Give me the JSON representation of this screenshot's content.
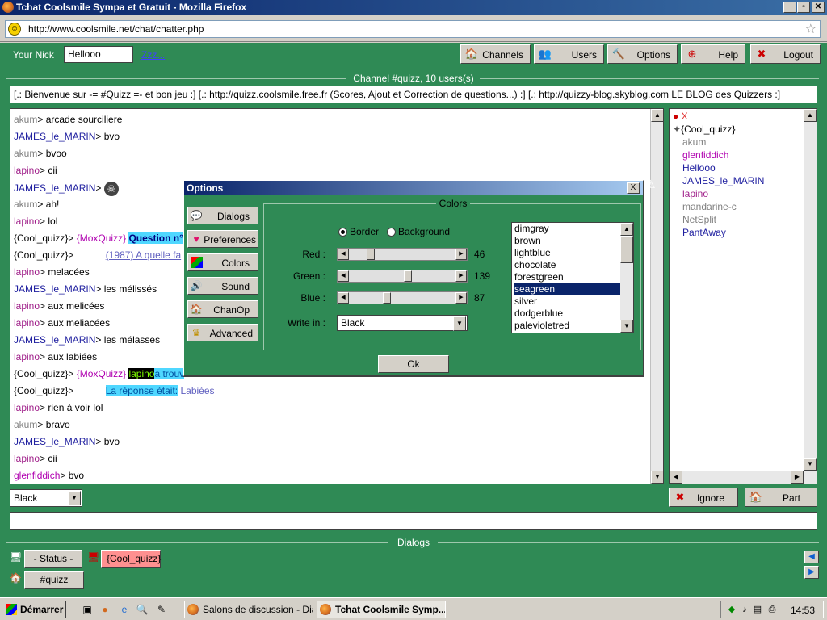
{
  "window": {
    "title": "Tchat Coolsmile Sympa et Gratuit - Mozilla Firefox",
    "minimize": "_",
    "maximize": "▫",
    "close": "✕"
  },
  "browser": {
    "url": "http://www.coolsmile.net/chat/chatter.php"
  },
  "header": {
    "nick_label": "Your Nick",
    "nick_value": "Hellooo",
    "zzz_link": "Zzz...",
    "buttons": [
      {
        "label": "Channels",
        "icon": "house-icon"
      },
      {
        "label": "Users",
        "icon": "users-icon"
      },
      {
        "label": "Options",
        "icon": "hammer-icon"
      },
      {
        "label": "Help",
        "icon": "lifebuoy-icon"
      },
      {
        "label": "Logout",
        "icon": "logout-icon"
      }
    ]
  },
  "channel": {
    "title": "Channel #quizz, 10 users(s)",
    "topic": "[.: Bienvenue sur -= #Quizz =- et bon jeu :] [.:  http://quizz.coolsmile.free.fr (Scores, Ajout et Correction de questions...) :] [.: http://quizzy-blog.skyblog.com LE BLOG des Quizzers :]"
  },
  "chat": {
    "lines": [
      {
        "nick": "akum",
        "sep": "> ",
        "text": "arcade sourciliere",
        "color": "gray"
      },
      {
        "nick": "JAMES_le_MARIN",
        "sep": "> ",
        "text": "bvo",
        "color": "blue"
      },
      {
        "nick": "akum",
        "sep": "> ",
        "text": "bvoo",
        "color": "gray"
      },
      {
        "nick": "lapino",
        "sep": "> ",
        "text": "cii",
        "color": "purple"
      },
      {
        "nick": "JAMES_le_MARIN",
        "sep": "> ",
        "text": "",
        "color": "blue",
        "icon": "skull-icon"
      },
      {
        "nick": "akum",
        "sep": "> ",
        "text": "ah!",
        "color": "gray"
      },
      {
        "nick": "lapino",
        "sep": "> ",
        "text": "lol",
        "color": "purple"
      },
      {
        "nick": "{Cool_quizz}",
        "sep": "> ",
        "text": "",
        "color": "black",
        "extra": "{MoxQuizz}",
        "highlight": "Question n°"
      },
      {
        "nick": "{Cool_quizz}",
        "sep": "> ",
        "text": "",
        "color": "black",
        "link": "(1987) A quelle fa"
      },
      {
        "nick": "lapino",
        "sep": "> ",
        "text": "melacées",
        "color": "purple"
      },
      {
        "nick": "JAMES_le_MARIN",
        "sep": "> ",
        "text": "les mélissés",
        "color": "blue"
      },
      {
        "nick": "lapino",
        "sep": "> ",
        "text": "aux melicées",
        "color": "purple"
      },
      {
        "nick": "lapino",
        "sep": "> ",
        "text": "aux meliacées",
        "color": "purple"
      },
      {
        "nick": "JAMES_le_MARIN",
        "sep": "> ",
        "text": "les mélasses",
        "color": "blue"
      },
      {
        "nick": "lapino",
        "sep": "> ",
        "text": "aux labiées",
        "color": "purple"
      },
      {
        "nick": "{Cool_quizz}",
        "sep": "> ",
        "text": "",
        "color": "black",
        "extra": "{MoxQuizz}",
        "winner": "lapino",
        "highlight": "a trouv"
      },
      {
        "nick": "{Cool_quizz}",
        "sep": "> ",
        "text": "",
        "color": "black",
        "highlight": "La réponse était:",
        "answer": "Labiées"
      },
      {
        "nick": "lapino",
        "sep": "> ",
        "text": "rien à voir lol",
        "color": "purple"
      },
      {
        "nick": "akum",
        "sep": "> ",
        "text": "bravo",
        "color": "gray"
      },
      {
        "nick": "JAMES_le_MARIN",
        "sep": "> ",
        "text": "bvo",
        "color": "blue"
      },
      {
        "nick": "lapino",
        "sep": "> ",
        "text": "cii",
        "color": "purple"
      },
      {
        "nick": "glenfiddich",
        "sep": "> ",
        "text": "bvo",
        "color": "magenta"
      }
    ]
  },
  "users": {
    "close_label": "X",
    "list": [
      {
        "name": "{Cool_quizz}",
        "color": "#000000"
      },
      {
        "name": "akum",
        "color": "#808080"
      },
      {
        "name": "glenfiddich",
        "color": "#b000b0"
      },
      {
        "name": "Hellooo",
        "color": "#2020a0"
      },
      {
        "name": "JAMES_le_MARIN",
        "color": "#2020a0"
      },
      {
        "name": "lapino",
        "color": "#a0208a"
      },
      {
        "name": "mandarine-c",
        "color": "#808080"
      },
      {
        "name": "NetSplit",
        "color": "#808080"
      },
      {
        "name": "PantAway",
        "color": "#2020a0"
      }
    ]
  },
  "bottom": {
    "color_select": "Black",
    "ignore_label": "Ignore",
    "part_label": "Part",
    "dialogs_title": "Dialogs",
    "status_label": "- Status -",
    "cool_quizz_label": "{Cool_quizz}",
    "quizz_label": "#quizz"
  },
  "options_dialog": {
    "title": "Options",
    "close": "X",
    "side_buttons": [
      {
        "label": "Dialogs",
        "icon": "speech-bubble-icon"
      },
      {
        "label": "Preferences",
        "icon": "heart-icon"
      },
      {
        "label": "Colors",
        "icon": "palette-icon"
      },
      {
        "label": "Sound",
        "icon": "speaker-icon"
      },
      {
        "label": "ChanOp",
        "icon": "house-icon"
      },
      {
        "label": "Advanced",
        "icon": "crown-icon"
      }
    ],
    "colors": {
      "title": "Colors",
      "border_label": "Border",
      "background_label": "Background",
      "red_label": "Red :",
      "green_label": "Green :",
      "blue_label": "Blue :",
      "red_value": "46",
      "green_value": "139",
      "blue_value": "87",
      "red": 46,
      "green": 139,
      "blue": 87,
      "write_in_label": "Write in :",
      "write_in_value": "Black",
      "color_names": [
        "dimgray",
        "brown",
        "lightblue",
        "chocolate",
        "forestgreen",
        "seagreen",
        "silver",
        "dodgerblue",
        "palevioletred"
      ],
      "selected_color": "seagreen"
    },
    "ok_label": "Ok"
  },
  "taskbar": {
    "start_label": "Démarrer",
    "tasks": [
      {
        "label": "Salons de discussion - Dial...",
        "active": false
      },
      {
        "label": "Tchat Coolsmile Symp...",
        "active": true
      }
    ],
    "clock": "14:53"
  },
  "colors": {
    "panel_green": "#2f8a55",
    "title_blue": "#0a246a",
    "highlight_cyan": "#4fd7ff"
  }
}
